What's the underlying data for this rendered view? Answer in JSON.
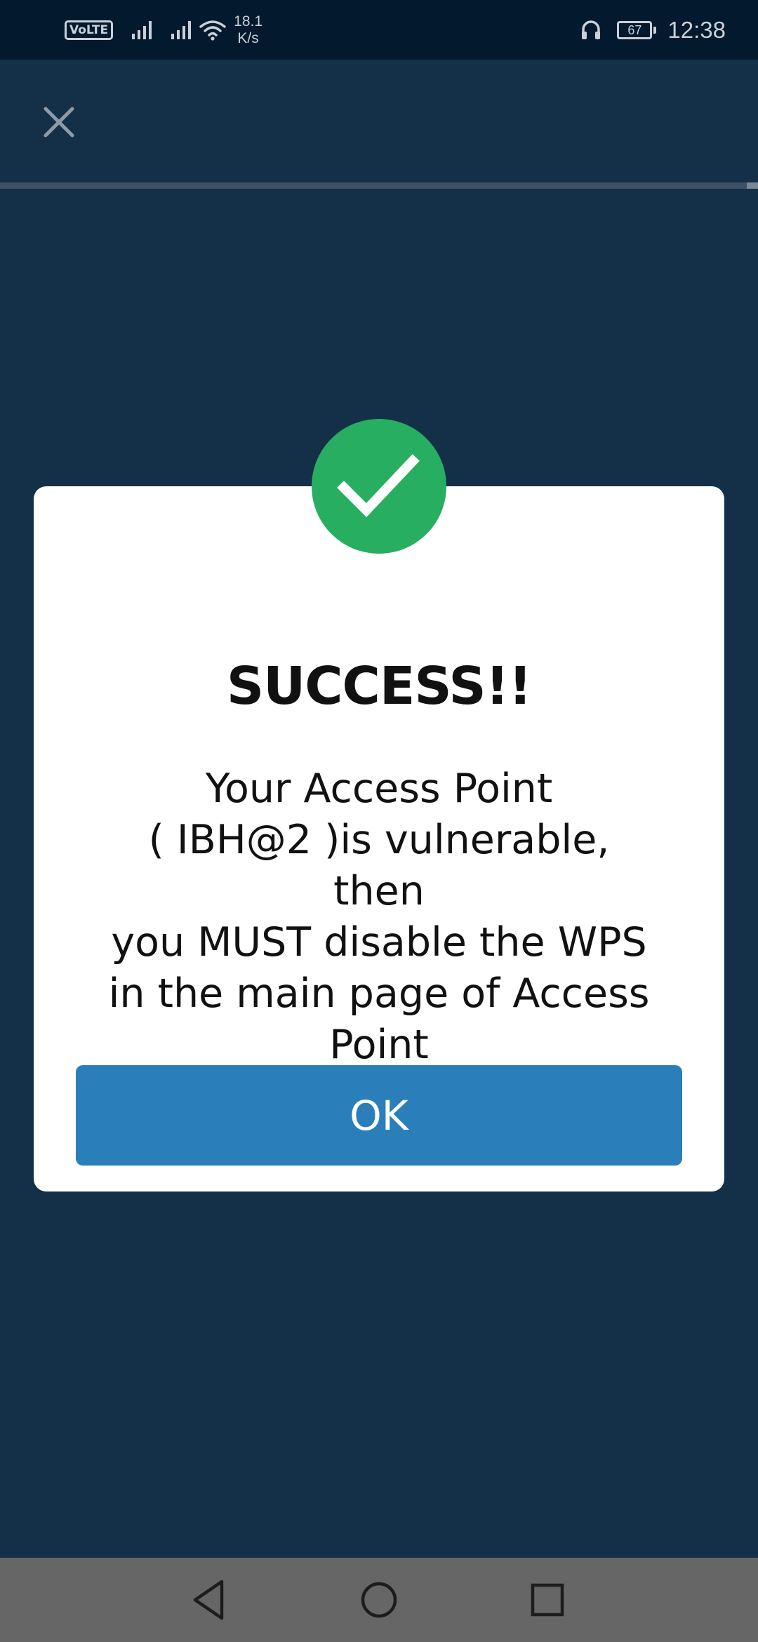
{
  "status_bar": {
    "volte": "VoLTE",
    "speed_value": "18.1",
    "speed_unit": "K/s",
    "battery": "67",
    "time": "12:38",
    "icons": [
      "signal-icon",
      "signal-icon",
      "wifi-icon",
      "headphones-icon",
      "battery-icon"
    ]
  },
  "app_bar": {
    "close_icon": "close-icon",
    "progress": 0.015
  },
  "dialog": {
    "icon": "check-icon",
    "title": "SUCCESS!!",
    "message_lines": [
      "Your Access Point",
      "( IBH@2 )is vulnerable, then",
      "you MUST disable the WPS",
      "in the main page of Access",
      "Point"
    ],
    "ok_label": "OK"
  },
  "nav_bar": {
    "icons": [
      "back-icon",
      "home-icon",
      "recents-icon"
    ]
  },
  "colors": {
    "background": "#143049",
    "status_bar": "#03192d",
    "success": "#27ae60",
    "button": "#2a7fbb",
    "nav_bar": "#666666"
  }
}
